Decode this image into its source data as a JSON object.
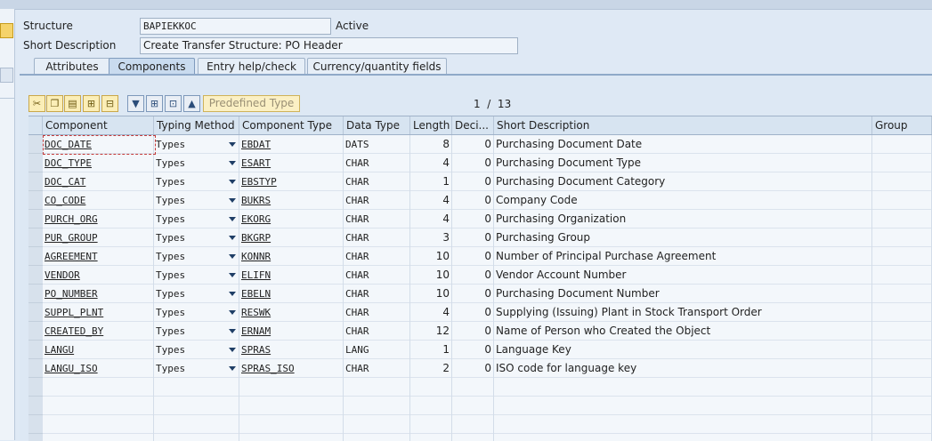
{
  "header": {
    "structure_label": "Structure",
    "structure_value": "BAPIEKKOC",
    "status": "Active",
    "short_desc_label": "Short Description",
    "short_desc_value": "Create Transfer Structure: PO Header"
  },
  "tabs": [
    {
      "label": "Attributes",
      "active": false
    },
    {
      "label": "Components",
      "active": true
    },
    {
      "label": "Entry help/check",
      "active": false
    },
    {
      "label": "Currency/quantity fields",
      "active": false
    }
  ],
  "toolbar": {
    "icons": [
      "cut-icon",
      "copy-icon",
      "paste-icon",
      "insert-row-icon",
      "delete-row-icon",
      "filter-icon",
      "expand-icon",
      "collapse-icon",
      "move-up-icon"
    ],
    "predefined_type_label": "Predefined Type",
    "page_info": "1  /  13"
  },
  "table": {
    "columns": [
      "Component",
      "Typing Method",
      "Component Type",
      "Data Type",
      "Length",
      "Deci...",
      "Short Description",
      "Group"
    ],
    "rows": [
      {
        "component": "DOC_DATE",
        "typing": "Types",
        "ctype": "EBDAT",
        "dtype": "DATS",
        "length": "8",
        "dec": "0",
        "desc": "Purchasing Document Date"
      },
      {
        "component": "DOC_TYPE",
        "typing": "Types",
        "ctype": "ESART",
        "dtype": "CHAR",
        "length": "4",
        "dec": "0",
        "desc": "Purchasing Document Type"
      },
      {
        "component": "DOC_CAT",
        "typing": "Types",
        "ctype": "EBSTYP",
        "dtype": "CHAR",
        "length": "1",
        "dec": "0",
        "desc": "Purchasing Document Category"
      },
      {
        "component": "CO_CODE",
        "typing": "Types",
        "ctype": "BUKRS",
        "dtype": "CHAR",
        "length": "4",
        "dec": "0",
        "desc": "Company Code"
      },
      {
        "component": "PURCH_ORG",
        "typing": "Types",
        "ctype": "EKORG",
        "dtype": "CHAR",
        "length": "4",
        "dec": "0",
        "desc": "Purchasing Organization"
      },
      {
        "component": "PUR_GROUP",
        "typing": "Types",
        "ctype": "BKGRP",
        "dtype": "CHAR",
        "length": "3",
        "dec": "0",
        "desc": "Purchasing Group"
      },
      {
        "component": "AGREEMENT",
        "typing": "Types",
        "ctype": "KONNR",
        "dtype": "CHAR",
        "length": "10",
        "dec": "0",
        "desc": "Number of Principal Purchase Agreement"
      },
      {
        "component": "VENDOR",
        "typing": "Types",
        "ctype": "ELIFN",
        "dtype": "CHAR",
        "length": "10",
        "dec": "0",
        "desc": "Vendor Account Number"
      },
      {
        "component": "PO_NUMBER",
        "typing": "Types",
        "ctype": "EBELN",
        "dtype": "CHAR",
        "length": "10",
        "dec": "0",
        "desc": "Purchasing Document Number"
      },
      {
        "component": "SUPPL_PLNT",
        "typing": "Types",
        "ctype": "RESWK",
        "dtype": "CHAR",
        "length": "4",
        "dec": "0",
        "desc": "Supplying (Issuing) Plant in Stock Transport Order"
      },
      {
        "component": "CREATED_BY",
        "typing": "Types",
        "ctype": "ERNAM",
        "dtype": "CHAR",
        "length": "12",
        "dec": "0",
        "desc": "Name of Person who Created the Object"
      },
      {
        "component": "LANGU",
        "typing": "Types",
        "ctype": "SPRAS",
        "dtype": "LANG",
        "length": "1",
        "dec": "0",
        "desc": "Language Key"
      },
      {
        "component": "LANGU_ISO",
        "typing": "Types",
        "ctype": "SPRAS_ISO",
        "dtype": "CHAR",
        "length": "2",
        "dec": "0",
        "desc": "ISO code for language key"
      }
    ],
    "empty_rows": 4
  }
}
